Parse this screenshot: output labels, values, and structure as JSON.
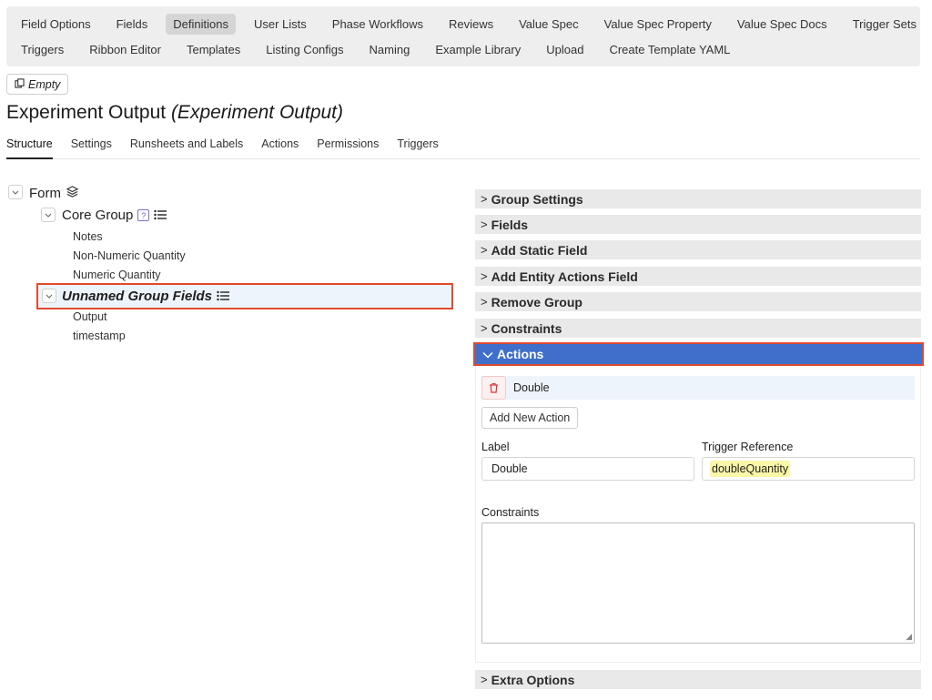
{
  "nav": {
    "row1": [
      "Field Options",
      "Fields",
      "Definitions",
      "User Lists",
      "Phase Workflows",
      "Reviews",
      "Value Spec",
      "Value Spec Property",
      "Value Spec Docs",
      "Trigger Sets"
    ],
    "row2": [
      "Triggers",
      "Ribbon Editor",
      "Templates",
      "Listing Configs",
      "Naming",
      "Example Library",
      "Upload",
      "Create Template YAML"
    ],
    "active": "Definitions"
  },
  "empty_button": "Empty",
  "page": {
    "title": "Experiment Output",
    "subtitle": "(Experiment Output)"
  },
  "tabs": [
    "Structure",
    "Settings",
    "Runsheets and Labels",
    "Actions",
    "Permissions",
    "Triggers"
  ],
  "active_tab": "Structure",
  "tree": {
    "root": "Form",
    "core_group": {
      "label": "Core Group",
      "help": "?",
      "fields": [
        "Notes",
        "Non-Numeric Quantity",
        "Numeric Quantity"
      ]
    },
    "unnamed_group": {
      "label": "Unnamed Group Fields",
      "fields": [
        "Output",
        "timestamp"
      ]
    }
  },
  "sections": {
    "group_settings": "Group Settings",
    "fields": "Fields",
    "add_static_field": "Add Static Field",
    "add_entity_actions_field": "Add Entity Actions Field",
    "remove_group": "Remove Group",
    "constraints": "Constraints",
    "actions": "Actions",
    "extra_options": "Extra Options"
  },
  "actions_panel": {
    "action_item": "Double",
    "add_button": "Add New Action",
    "label_caption": "Label",
    "label_value": "Double",
    "trigger_caption": "Trigger Reference",
    "trigger_value": "doubleQuantity",
    "constraints_caption": "Constraints",
    "constraints_value": ""
  },
  "colors": {
    "accent": "#3f6fcb",
    "highlight_border": "#e04a2f",
    "trigger_highlight": "#fbf7a8"
  }
}
